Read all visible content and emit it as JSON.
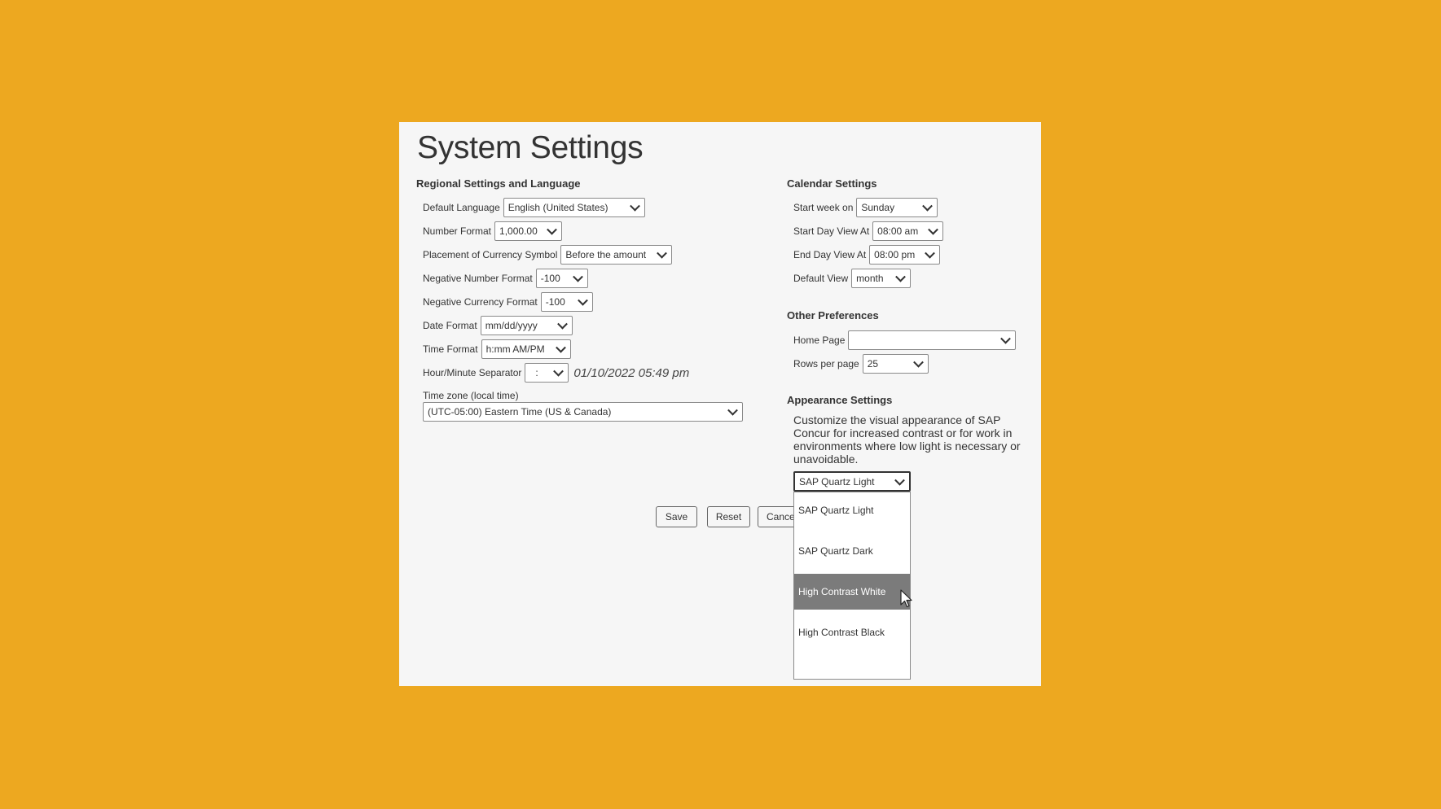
{
  "page": {
    "title": "System Settings"
  },
  "regional": {
    "heading": "Regional Settings and Language",
    "default_language": {
      "label": "Default Language",
      "value": "English (United States)"
    },
    "number_format": {
      "label": "Number Format",
      "value": "1,000.00"
    },
    "currency_placement": {
      "label": "Placement of Currency Symbol",
      "value": "Before the amount"
    },
    "negative_number": {
      "label": "Negative Number Format",
      "value": "-100"
    },
    "negative_currency": {
      "label": "Negative Currency Format",
      "value": "-100"
    },
    "date_format": {
      "label": "Date Format",
      "value": "mm/dd/yyyy"
    },
    "time_format": {
      "label": "Time Format",
      "value": "h:mm AM/PM"
    },
    "separator": {
      "label": "Hour/Minute Separator",
      "value": ":",
      "preview": "01/10/2022 05:49 pm"
    },
    "timezone": {
      "label": "Time zone (local time)",
      "value": "(UTC-05:00) Eastern Time (US & Canada)"
    }
  },
  "calendar": {
    "heading": "Calendar Settings",
    "start_week": {
      "label": "Start week on",
      "value": "Sunday"
    },
    "start_day": {
      "label": "Start Day View At",
      "value": "08:00 am"
    },
    "end_day": {
      "label": "End Day View At",
      "value": "08:00 pm"
    },
    "default_view": {
      "label": "Default View",
      "value": "month"
    }
  },
  "other": {
    "heading": "Other Preferences",
    "home_page": {
      "label": "Home Page",
      "value": ""
    },
    "rows_per_page": {
      "label": "Rows per page",
      "value": "25"
    }
  },
  "appearance": {
    "heading": "Appearance Settings",
    "description": "Customize the visual appearance of SAP Concur for increased contrast or for work in environments where low light is necessary or unavoidable.",
    "selected": "SAP Quartz Light",
    "options": [
      "SAP Quartz Light",
      "SAP Quartz Dark",
      "High Contrast White",
      "High Contrast Black"
    ],
    "highlighted_index": 2
  },
  "buttons": {
    "save": "Save",
    "reset": "Reset",
    "cancel": "Cancel"
  },
  "colors": {
    "background": "#EDA820",
    "panel": "#f6f6f6",
    "highlight": "#7b7b7b"
  }
}
